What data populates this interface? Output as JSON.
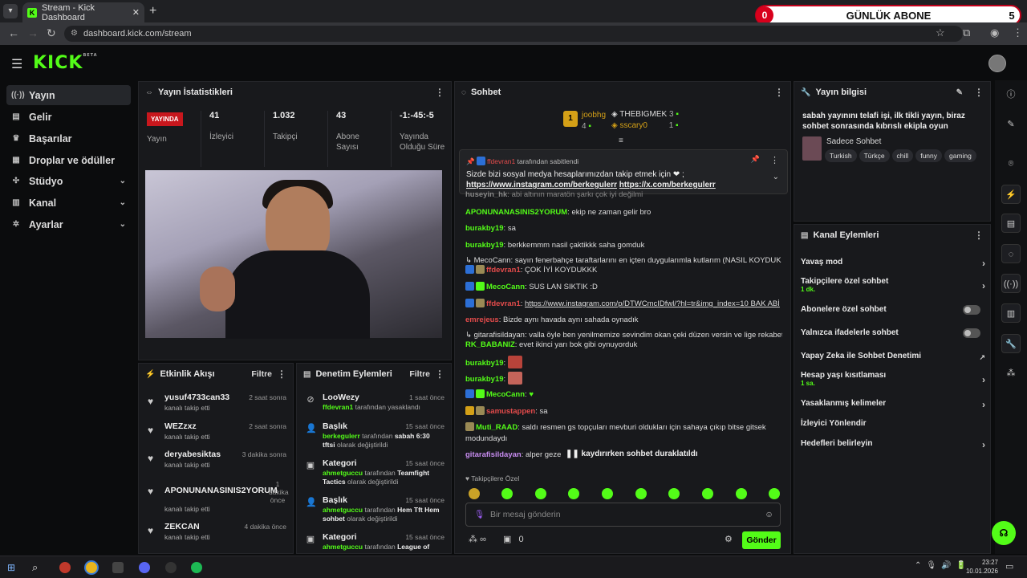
{
  "browser": {
    "tab_title": "Stream - Kick Dashboard",
    "url": "dashboard.kick.com/stream",
    "minimize": "—",
    "restore": "❐",
    "close": "✕"
  },
  "overlay": {
    "count": "0",
    "title": "GÜNLÜK ABONE",
    "right_count": "5"
  },
  "logo": {
    "text": "KICK",
    "beta": "BETA"
  },
  "sidebar": {
    "items": [
      {
        "label": "Yayın",
        "icon": "broadcast-icon"
      },
      {
        "label": "Gelir",
        "icon": "revenue-icon"
      },
      {
        "label": "Başarılar",
        "icon": "trophy-icon"
      },
      {
        "label": "Droplar ve ödüller",
        "icon": "gift-icon"
      },
      {
        "label": "Stüdyo",
        "icon": "studio-icon"
      },
      {
        "label": "Kanal",
        "icon": "channel-icon"
      },
      {
        "label": "Ayarlar",
        "icon": "gear-icon"
      }
    ]
  },
  "stats": {
    "title": "Yayın İstatistikleri",
    "live": "YAYINDA",
    "live_label": "Yayın",
    "viewers": "41",
    "viewers_label": "İzleyici",
    "followers": "1.032",
    "followers_label": "Takipçi",
    "subs": "43",
    "subs_label": "Abone Sayısı",
    "uptime": "-1:-45:-5",
    "uptime_label": "Yayında Olduğu Süre"
  },
  "activity": {
    "title": "Etkinlik Akışı",
    "filter": "Filtre",
    "events": [
      {
        "name": "yusuf4733can33",
        "desc": "kanalı takip etti",
        "time": "2 saat sonra"
      },
      {
        "name": "WEZzxz",
        "desc": "kanalı takip etti",
        "time": "2 saat sonra"
      },
      {
        "name": "deryabesiktas",
        "desc": "kanalı takip etti",
        "time": "3 dakika sonra"
      },
      {
        "name": "APONUNANASINIS2YORUM",
        "desc": "kanalı takip etti",
        "time": "1 dakika önce"
      },
      {
        "name": "ZEKCAN",
        "desc": "kanalı takip etti",
        "time": "4 dakika önce"
      }
    ]
  },
  "mod": {
    "title": "Denetim Eylemleri",
    "filter": "Filtre",
    "items": [
      {
        "name": "LooWezy",
        "time": "1 saat önce",
        "user": "ffdevran1",
        "desc": "tarafından yasaklandı"
      },
      {
        "name": "Başlık",
        "time": "15 saat önce",
        "user": "berkegulerr",
        "desc": "tarafından",
        "val": "sabah 6:30 tftsi",
        "tail": "olarak değiştirildi"
      },
      {
        "name": "Kategori",
        "time": "15 saat önce",
        "user": "ahmetguccu",
        "desc": "tarafından",
        "val": "Teamfight Tactics",
        "tail": "olarak değiştirildi"
      },
      {
        "name": "Başlık",
        "time": "15 saat önce",
        "user": "ahmetguccu",
        "desc": "tarafından",
        "val": "Hem Tft Hem sohbet",
        "tail": "olarak değiştirildi"
      },
      {
        "name": "Kategori",
        "time": "15 saat önce",
        "user": "ahmetguccu",
        "desc": "tarafından",
        "val": "League of",
        "tail": ""
      }
    ]
  },
  "chat": {
    "title": "Sohbet",
    "leader1": {
      "name": "joobhg",
      "count": "4"
    },
    "leader2": {
      "name": "THEBIGMEK",
      "count": "3"
    },
    "leader3": {
      "name": "sscary0",
      "count": "1"
    },
    "pinned": {
      "by": "ffdevran1",
      "by_suffix": "tarafından sabitlendi",
      "text": "Sizde bizi sosyal medya hesaplarımızdan takip etmek için ❤ ;",
      "link1": "https://www.instagram.com/berkegulerr",
      "link2": "https://x.com/berkegulerr"
    },
    "messages": [
      {
        "user": "huseyin_hk",
        "color": "#8ab4f8",
        "text": "abi altının maratön şarkı çok iyi değilmi"
      },
      {
        "user": "APONUNANASINIS2YORUM",
        "color": "#53fc18",
        "text": "ekip ne zaman gelir bro"
      },
      {
        "user": "burakby19",
        "color": "#53fc18",
        "text": "sa"
      },
      {
        "user": "burakby19",
        "color": "#53fc18",
        "text": "berkkemmm nasil çaktikkk saha gomduk"
      },
      {
        "sys": "↳ MecoCann: sayın fenerbahçe taraftarlarını en içten duygularımla kutlarım (NASIL KOYDUK AMA ) I..."
      },
      {
        "user": "ffdevran1",
        "color": "#e34b4b",
        "text": "ÇOK İYİ KOYDUKKK"
      },
      {
        "user": "MecoCann",
        "color": "#53fc18",
        "text": "SUS LAN SIKTIK :D"
      },
      {
        "user": "ffdevran1",
        "color": "#e34b4b",
        "text": "https://www.instagram.com/p/DTWCmcIDfwl/?hl=tr&img_index=10 BAK ABİ"
      },
      {
        "user": "emrejeus",
        "color": "#e34b4b",
        "text": "Bizde aynı havada aynı sahada oynadık"
      },
      {
        "sys": "↳ gitarafisildayan: valla öyle ben yenilmemize sevindim okan çeki düzen versin ve lige rekabet geldi..."
      },
      {
        "user": "RK_BABANIZ",
        "color": "#53fc18",
        "text": "evet ikinci yarı bok gibi oynuyorduk"
      },
      {
        "user": "burakby19",
        "color": "#53fc18",
        "text": ""
      },
      {
        "user": "burakby19",
        "color": "#53fc18",
        "text": ""
      },
      {
        "user": "MecoCann",
        "color": "#53fc18",
        "text": "♥"
      },
      {
        "user": "samustappen",
        "color": "#e34b4b",
        "text": "sa"
      },
      {
        "user": "Muti_RAAD",
        "color": "#53fc18",
        "text": "saldı resmen gs topçuları mevburi oldukları için sahaya çıkıp bitse gitsek"
      },
      {
        "cont": "modundaydı"
      },
      {
        "user": "gitarafisildayan",
        "color": "#c78cf0",
        "text": "alper geze"
      }
    ],
    "paused": "kaydırırken sohbet duraklatıldı",
    "followers_only": "Takipçilere Özel",
    "placeholder": "Bir mesaj gönderin",
    "points": "∞",
    "count": "0",
    "send": "Gönder"
  },
  "info": {
    "title": "Yayın bilgisi",
    "stream_title": "sabah yayınını telafi işi, ilk tikli yayın, biraz sohbet sonrasında kıbrıslı ekipla oyun",
    "category": "Sadece Sohbet",
    "tags": [
      "Turkish",
      "Türkçe",
      "chill",
      "funny",
      "gaming"
    ]
  },
  "actions": {
    "title": "Kanal Eylemleri",
    "items": [
      {
        "label": "Yavaş mod",
        "kind": "chev"
      },
      {
        "label": "Takipçilere özel sohbet",
        "sub": "1 dk.",
        "kind": "chev"
      },
      {
        "label": "Abonelere özel sohbet",
        "kind": "toggle"
      },
      {
        "label": "Yalnızca ifadelerle sohbet",
        "kind": "toggle"
      },
      {
        "label": "Yapay Zeka ile Sohbet Denetimi",
        "kind": "ext"
      },
      {
        "label": "Hesap yaşı kısıtlaması",
        "sub": "1 sa.",
        "kind": "chev"
      },
      {
        "label": "Yasaklanmış kelimeler",
        "kind": "chev"
      },
      {
        "label": "İzleyici Yönlendir",
        "kind": "none"
      },
      {
        "label": "Hedefleri belirleyin",
        "kind": "chev"
      }
    ]
  },
  "taskbar": {
    "time": "23:27",
    "date": "10.01.2026"
  }
}
